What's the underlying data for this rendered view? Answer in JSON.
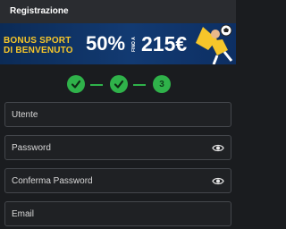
{
  "header": {
    "title": "Registrazione"
  },
  "banner": {
    "line1": "BONUS SPORT",
    "line2": "DI BENVENUTO",
    "percent": "50%",
    "up_to": "FINO A",
    "amount": "215€",
    "accent_color": "#f6c62a",
    "background_color": "#123a72"
  },
  "stepper": {
    "steps": [
      {
        "state": "completed",
        "icon": "check-icon"
      },
      {
        "state": "completed",
        "icon": "check-icon"
      },
      {
        "state": "current",
        "label": "3"
      }
    ],
    "color": "#2fb24a"
  },
  "form": {
    "username": {
      "placeholder": "Utente",
      "value": ""
    },
    "password": {
      "placeholder": "Password",
      "value": "",
      "toggle_icon": "eye-icon"
    },
    "confirm_password": {
      "placeholder": "Conferma Password",
      "value": "",
      "toggle_icon": "eye-icon"
    },
    "email": {
      "placeholder": "Email",
      "value": ""
    }
  }
}
